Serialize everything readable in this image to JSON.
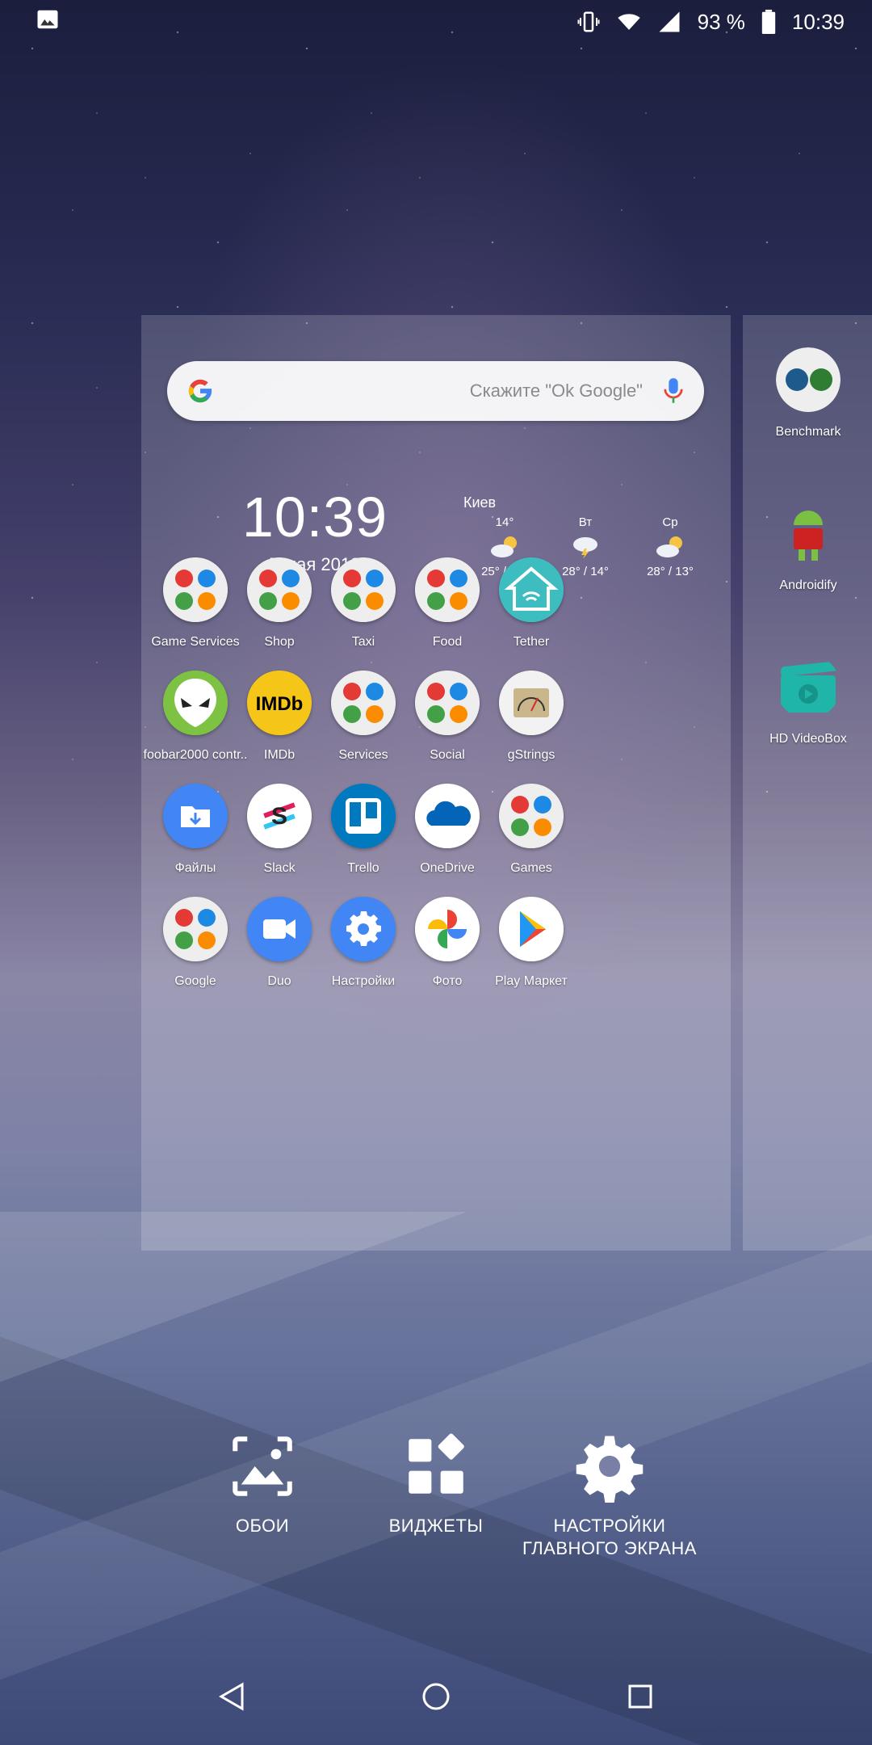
{
  "status": {
    "battery": "93 %",
    "time": "10:39"
  },
  "search": {
    "hint": "Скажите \"Ok Google\""
  },
  "clock": {
    "time": "10:39",
    "date": "7 мая 2018"
  },
  "weather": {
    "city": "Киев",
    "days": [
      {
        "label": "14°",
        "range": "25° / 14°"
      },
      {
        "label": "Вт",
        "range": "28° / 14°"
      },
      {
        "label": "Ср",
        "range": "28° / 13°"
      }
    ]
  },
  "apps": [
    {
      "label": "Game Services",
      "icon": "folder-icon",
      "color": "#e8e8e8"
    },
    {
      "label": "Shop",
      "icon": "folder-icon",
      "color": "#e8e8e8"
    },
    {
      "label": "Taxi",
      "icon": "folder-icon",
      "color": "#e8e8e8"
    },
    {
      "label": "Food",
      "icon": "folder-icon",
      "color": "#e8e8e8"
    },
    {
      "label": "Tether",
      "icon": "home-wifi-icon",
      "color": "#3dbdbf"
    },
    {
      "label": "foobar2000 contr..",
      "icon": "alien-icon",
      "color": "#7dc242"
    },
    {
      "label": "IMDb",
      "icon": "imdb-icon",
      "color": "#f5c518"
    },
    {
      "label": "Services",
      "icon": "folder-icon",
      "color": "#e8e8e8"
    },
    {
      "label": "Social",
      "icon": "folder-icon",
      "color": "#e8e8e8"
    },
    {
      "label": "gStrings",
      "icon": "tuner-icon",
      "color": "#f2f2f2"
    },
    {
      "label": "Файлы",
      "icon": "files-icon",
      "color": "#4285f4"
    },
    {
      "label": "Slack",
      "icon": "slack-icon",
      "color": "#ffffff"
    },
    {
      "label": "Trello",
      "icon": "trello-icon",
      "color": "#0079bf"
    },
    {
      "label": "OneDrive",
      "icon": "onedrive-icon",
      "color": "#ffffff"
    },
    {
      "label": "Games",
      "icon": "folder-icon",
      "color": "#e8e8e8"
    },
    {
      "label": "Google",
      "icon": "folder-icon",
      "color": "#e8e8e8"
    },
    {
      "label": "Duo",
      "icon": "duo-icon",
      "color": "#4285f4"
    },
    {
      "label": "Настройки",
      "icon": "gear-icon",
      "color": "#4285f4"
    },
    {
      "label": "Фото",
      "icon": "photos-icon",
      "color": "#ffffff"
    },
    {
      "label": "Play Маркет",
      "icon": "play-store-icon",
      "color": "#ffffff"
    }
  ],
  "side_apps": [
    {
      "label": "Benchmark",
      "icon": "benchmark-icon",
      "color": "#e8e8e8"
    },
    {
      "label": "Androidify",
      "icon": "android-icon",
      "color": "#cc2222"
    },
    {
      "label": "HD VideoBox",
      "icon": "clapper-icon",
      "color": "#1fb5a8"
    }
  ],
  "options": {
    "wallpaper": "ОБОИ",
    "widgets": "ВИДЖЕТЫ",
    "settings_line1": "НАСТРОЙКИ",
    "settings_line2": "ГЛАВНОГО ЭКРАНА"
  }
}
